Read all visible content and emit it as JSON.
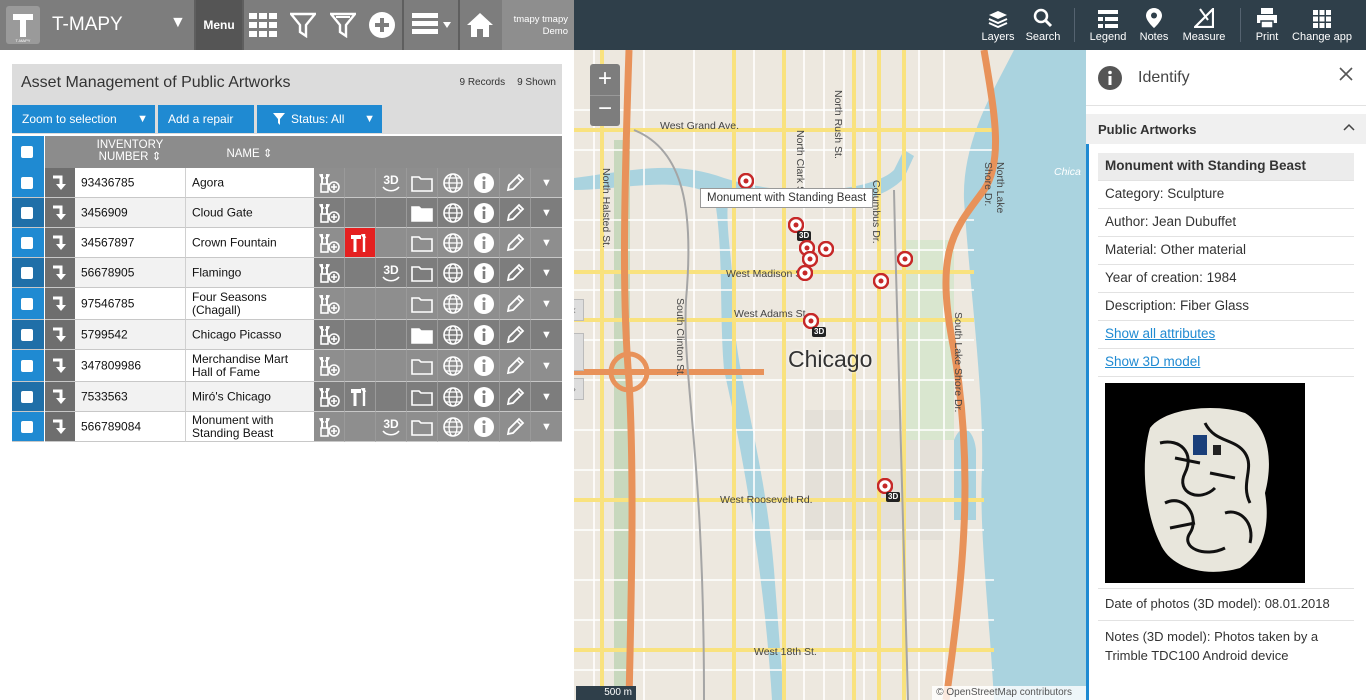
{
  "app": {
    "title": "T-MAPY",
    "menu_label": "Menu",
    "user": [
      "tmapy tmapy",
      "Demo"
    ]
  },
  "toolbar_right": [
    {
      "label": "Layers",
      "icon": "layers-icon"
    },
    {
      "label": "Search",
      "icon": "search-icon"
    },
    {
      "label": "Legend",
      "icon": "legend-icon"
    },
    {
      "label": "Notes",
      "icon": "pin-icon"
    },
    {
      "label": "Measure",
      "icon": "measure-icon"
    },
    {
      "label": "Print",
      "icon": "print-icon"
    },
    {
      "label": "Change app",
      "icon": "apps-grid-icon"
    }
  ],
  "panel": {
    "title": "Asset Management of Public Artworks",
    "records": "9 Records",
    "shown": "9 Shown",
    "zoom_label": "Zoom to selection",
    "repair_label": "Add a repair",
    "status_label": "Status: All",
    "col_inventory": [
      "INVENTORY",
      "NUMBER"
    ],
    "col_name": "NAME"
  },
  "rows": [
    {
      "inv": "93436785",
      "name": "Agora",
      "repair": false,
      "model3d": true,
      "folder": true
    },
    {
      "inv": "3456909",
      "name": "Cloud Gate",
      "repair": false,
      "model3d": false,
      "folder": true
    },
    {
      "inv": "34567897",
      "name": "Crown Fountain",
      "repair": true,
      "model3d": false,
      "folder": true
    },
    {
      "inv": "56678905",
      "name": "Flamingo",
      "repair": false,
      "model3d": true,
      "folder": true
    },
    {
      "inv": "97546785",
      "name": "Four Seasons (Chagall)",
      "repair": false,
      "model3d": false,
      "folder": true
    },
    {
      "inv": "5799542",
      "name": "Chicago Picasso",
      "repair": false,
      "model3d": false,
      "folder": true
    },
    {
      "inv": "347809986",
      "name": "Merchandise Mart Hall of Fame",
      "repair": false,
      "model3d": false,
      "folder": true
    },
    {
      "inv": "7533563",
      "name": "Miró's Chicago",
      "repair": false,
      "model3d": false,
      "folder": true
    },
    {
      "inv": "566789084",
      "name": "Monument with Standing Beast",
      "repair": false,
      "model3d": true,
      "folder": true
    }
  ],
  "map": {
    "tooltip": "Monument with Standing Beast",
    "city_label": "Chicago",
    "street_labels": [
      "West Grand Ave.",
      "North Rush St.",
      "North Clark St.",
      "North Halsted St.",
      "West Madison St.",
      "West Adams St.",
      "South Clinton St.",
      "South Lake Shore Dr.",
      "West Roosevelt Rd.",
      "West 18th St.",
      "North Lake Shore Dr.",
      "Columbus Dr."
    ],
    "scale": "500 m",
    "attribution": "© OpenStreetMap contributors",
    "badge_3d": "3D",
    "chicago_river": "Chica"
  },
  "identify": {
    "title": "Identify",
    "section": "Public Artworks",
    "name": "Monument with Standing Beast",
    "category": "Category: Sculpture",
    "author": "Author: Jean Dubuffet",
    "material": "Material: Other material",
    "year": "Year of creation: 1984",
    "description": "Description: Fiber Glass",
    "show_attributes": "Show all attributes",
    "show_3d": "Show 3D model",
    "date_photos": "Date of photos (3D model): 08.01.2018",
    "notes": "Notes (3D model): Photos taken by a Trimble TDC100 Android device"
  }
}
